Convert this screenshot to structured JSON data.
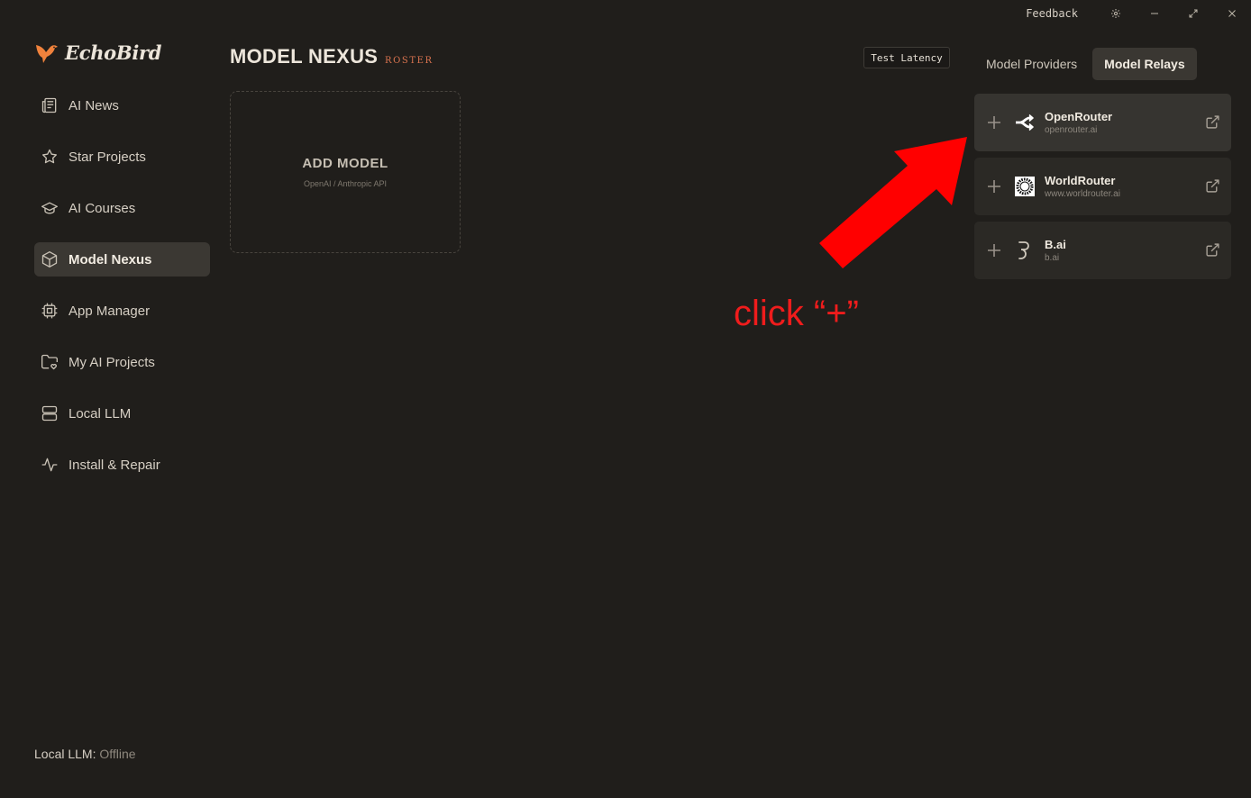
{
  "window": {
    "feedback_label": "Feedback",
    "icons": [
      "gear-icon",
      "minimize-icon",
      "maximize-icon",
      "close-icon"
    ]
  },
  "app": {
    "name": "EchoBird",
    "accent_color": "#f0823c"
  },
  "sidebar": {
    "items": [
      {
        "label": "AI News",
        "icon": "newspaper-icon",
        "active": false
      },
      {
        "label": "Star Projects",
        "icon": "star-icon",
        "active": false
      },
      {
        "label": "AI Courses",
        "icon": "graduation-cap-icon",
        "active": false
      },
      {
        "label": "Model Nexus",
        "icon": "cube-icon",
        "active": true
      },
      {
        "label": "App Manager",
        "icon": "chip-icon",
        "active": false
      },
      {
        "label": "My AI Projects",
        "icon": "folder-heart-icon",
        "active": false
      },
      {
        "label": "Local LLM",
        "icon": "server-icon",
        "active": false
      },
      {
        "label": "Install & Repair",
        "icon": "activity-icon",
        "active": false
      }
    ],
    "status_label": "Local LLM:",
    "status_value": "Offline"
  },
  "main": {
    "title": "MODEL NEXUS",
    "subtitle": "ROSTER",
    "add_model": {
      "title": "ADD MODEL",
      "subtitle": "OpenAI / Anthropic API"
    },
    "test_latency_label": "Test Latency"
  },
  "right_panel": {
    "tabs": [
      {
        "label": "Model Providers",
        "active": false
      },
      {
        "label": "Model Relays",
        "active": true
      }
    ],
    "relays": [
      {
        "name": "OpenRouter",
        "url": "openrouter.ai",
        "icon": "openrouter-logo-icon"
      },
      {
        "name": "WorldRouter",
        "url": "www.worldrouter.ai",
        "icon": "worldrouter-logo-icon"
      },
      {
        "name": "B.ai",
        "url": "b.ai",
        "icon": "bai-logo-icon"
      }
    ]
  },
  "annotation": {
    "text": "click “+”",
    "color": "#ef1c1c"
  }
}
